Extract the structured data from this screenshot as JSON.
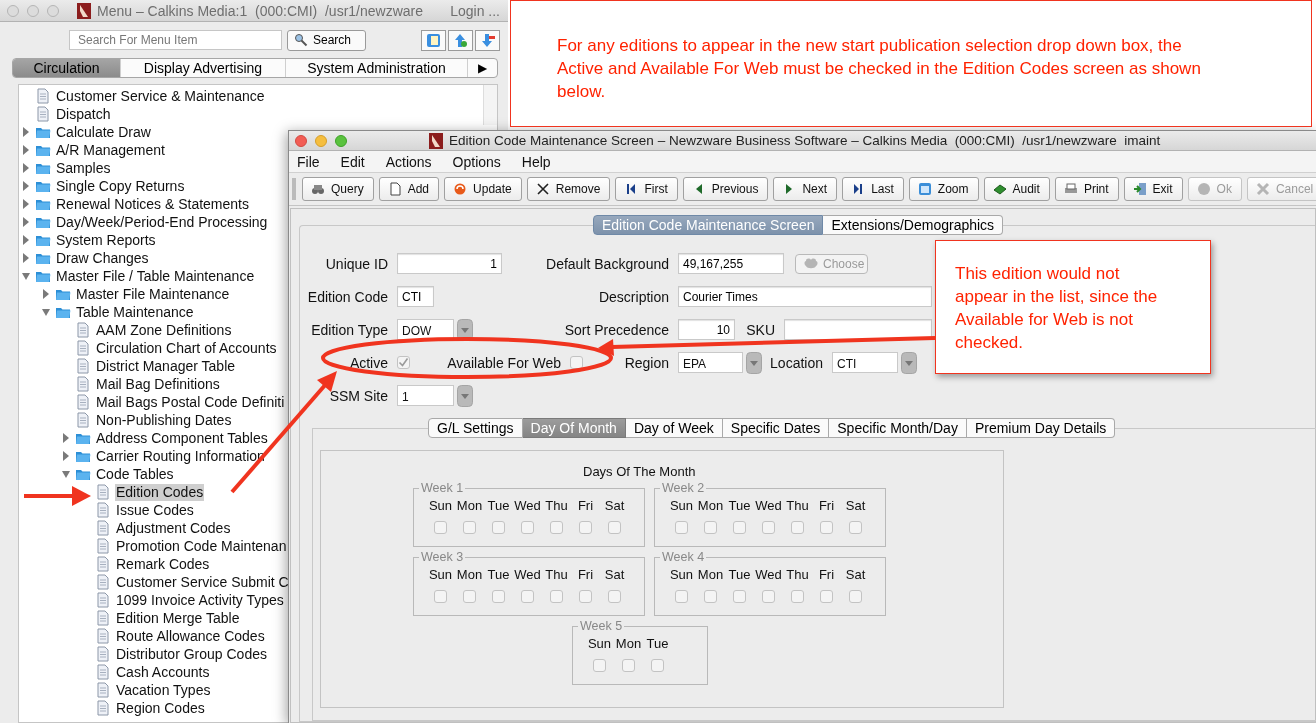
{
  "menu_window": {
    "title": "Menu – Calkins Media:1  (000:CMI)  /usr1/newzware",
    "login": "Login ...",
    "search": {
      "placeholder": "Search For Menu Item"
    },
    "search_button": "Search",
    "tabs": [
      {
        "label": "Circulation",
        "selected": true
      },
      {
        "label": "Display Advertising",
        "selected": false
      },
      {
        "label": "System Administration",
        "selected": false
      }
    ],
    "tab_scroll": "▶",
    "tree": [
      {
        "label": "Customer Service & Maintenance",
        "kind": "document",
        "selected": false
      },
      {
        "label": "Dispatch",
        "kind": "document",
        "selected": false
      },
      {
        "label": "Calculate Draw",
        "kind": "folder",
        "expanded": false,
        "selected": false
      },
      {
        "label": "A/R Management",
        "kind": "folder",
        "expanded": false,
        "selected": false
      },
      {
        "label": "Samples",
        "kind": "folder",
        "expanded": false,
        "selected": false
      },
      {
        "label": "Single Copy Returns",
        "kind": "folder",
        "expanded": false,
        "selected": false
      },
      {
        "label": "Renewal Notices & Statements",
        "kind": "folder",
        "expanded": false,
        "selected": false
      },
      {
        "label": "Day/Week/Period-End Processing",
        "kind": "folder",
        "expanded": false,
        "selected": false
      },
      {
        "label": "System Reports",
        "kind": "folder",
        "expanded": false,
        "selected": false
      },
      {
        "label": "Draw Changes",
        "kind": "folder",
        "expanded": false,
        "selected": false
      },
      {
        "label": "Master File / Table Maintenance",
        "kind": "folder",
        "expanded": true,
        "selected": false,
        "children": [
          {
            "label": "Master File Maintenance",
            "kind": "folder",
            "expanded": false,
            "selected": false
          },
          {
            "label": "Table Maintenance",
            "kind": "folder",
            "expanded": true,
            "selected": false,
            "children": [
              {
                "label": "AAM Zone Definitions",
                "kind": "document",
                "selected": false
              },
              {
                "label": "Circulation Chart of Accounts",
                "kind": "document",
                "selected": false
              },
              {
                "label": "District Manager Table",
                "kind": "document",
                "selected": false
              },
              {
                "label": "Mail Bag Definitions",
                "kind": "document",
                "selected": false
              },
              {
                "label": "Mail Bags Postal Code Definiti",
                "kind": "document",
                "selected": false
              },
              {
                "label": "Non-Publishing Dates",
                "kind": "document",
                "selected": false
              },
              {
                "label": "Address Component Tables",
                "kind": "folder",
                "expanded": false,
                "selected": false
              },
              {
                "label": "Carrier Routing Information",
                "kind": "folder",
                "expanded": false,
                "selected": false
              },
              {
                "label": "Code Tables",
                "kind": "folder",
                "expanded": true,
                "selected": false,
                "children": [
                  {
                    "label": "Edition Codes",
                    "kind": "document",
                    "selected": true
                  },
                  {
                    "label": "Issue Codes",
                    "kind": "document",
                    "selected": false
                  },
                  {
                    "label": "Adjustment Codes",
                    "kind": "document",
                    "selected": false
                  },
                  {
                    "label": "Promotion Code Maintenan",
                    "kind": "document",
                    "selected": false
                  },
                  {
                    "label": "Remark Codes",
                    "kind": "document",
                    "selected": false
                  },
                  {
                    "label": "Customer Service Submit C",
                    "kind": "document",
                    "selected": false
                  },
                  {
                    "label": "1099 Invoice Activity Types",
                    "kind": "document",
                    "selected": false
                  },
                  {
                    "label": "Edition Merge Table",
                    "kind": "document",
                    "selected": false
                  },
                  {
                    "label": "Route Allowance Codes",
                    "kind": "document",
                    "selected": false
                  },
                  {
                    "label": "Distributor Group Codes",
                    "kind": "document",
                    "selected": false
                  },
                  {
                    "label": "Cash Accounts",
                    "kind": "document",
                    "selected": false
                  },
                  {
                    "label": "Vacation Types",
                    "kind": "document",
                    "selected": false
                  },
                  {
                    "label": "Region Codes",
                    "kind": "document",
                    "selected": false
                  }
                ]
              }
            ]
          }
        ]
      }
    ]
  },
  "edition_window": {
    "title": "Edition Code Maintenance Screen – Newzware Business Software – Calkins Media  (000:CMI)  /usr1/newzware  imaint",
    "menus": [
      "File",
      "Edit",
      "Actions",
      "Options",
      "Help"
    ],
    "toolbar": [
      {
        "label": "Query",
        "disabled": false
      },
      {
        "label": "Add",
        "disabled": false
      },
      {
        "label": "Update",
        "disabled": false
      },
      {
        "label": "Remove",
        "disabled": false
      },
      {
        "label": "First",
        "disabled": false
      },
      {
        "label": "Previous",
        "disabled": false
      },
      {
        "label": "Next",
        "disabled": false
      },
      {
        "label": "Last",
        "disabled": false
      },
      {
        "label": "Zoom",
        "disabled": false
      },
      {
        "label": "Audit",
        "disabled": false
      },
      {
        "label": "Print",
        "disabled": false
      },
      {
        "label": "Exit",
        "disabled": false
      },
      {
        "label": "Ok",
        "disabled": true
      },
      {
        "label": "Cancel",
        "disabled": true
      }
    ],
    "tabs": [
      {
        "label": "Edition Code Maintenance Screen",
        "selected": true
      },
      {
        "label": "Extensions/Demographics",
        "selected": false
      }
    ],
    "form_rows": [
      [
        {
          "kind": "number",
          "label": "Unique ID",
          "value": "1"
        },
        {
          "kind": "text",
          "label": "Default Background",
          "value": "49,167,255"
        },
        {
          "kind": "button",
          "label": "Choose",
          "disabled": true
        }
      ],
      [
        {
          "kind": "text",
          "label": "Edition Code",
          "value": "CTI"
        },
        {
          "kind": "text",
          "label": "Description",
          "value": "Courier Times"
        }
      ],
      [
        {
          "kind": "dropdown",
          "label": "Edition Type",
          "value": "DOW"
        },
        {
          "kind": "number",
          "label": "Sort Precedence",
          "value": "10"
        },
        {
          "kind": "text",
          "label": "SKU"
        }
      ],
      [
        {
          "kind": "checkbox",
          "label": "Active",
          "checked": true
        },
        {
          "kind": "checkbox",
          "label": "Available For Web",
          "checked": false
        },
        {
          "kind": "dropdown",
          "label": "Region",
          "value": "EPA"
        },
        {
          "kind": "dropdown",
          "label": "Location",
          "value": "CTI"
        }
      ],
      [
        {
          "kind": "dropdown",
          "label": "SSM Site",
          "value": "1"
        }
      ]
    ],
    "subtabs": [
      {
        "label": "G/L Settings",
        "selected": false
      },
      {
        "label": "Day Of Month",
        "selected": true
      },
      {
        "label": "Day of Week",
        "selected": false
      },
      {
        "label": "Specific Dates",
        "selected": false
      },
      {
        "label": "Specific Month/Day",
        "selected": false
      },
      {
        "label": "Premium Day Details",
        "selected": false
      }
    ],
    "days_panel": {
      "title": "Days Of The Month",
      "weeks": [
        {
          "label": "Week 1",
          "days": [
            {
              "label": "Sun",
              "checked": false
            },
            {
              "label": "Mon",
              "checked": false
            },
            {
              "label": "Tue",
              "checked": false
            },
            {
              "label": "Wed",
              "checked": false
            },
            {
              "label": "Thu",
              "checked": false
            },
            {
              "label": "Fri",
              "checked": false
            },
            {
              "label": "Sat",
              "checked": false
            }
          ]
        },
        {
          "label": "Week 2",
          "days": [
            {
              "label": "Sun",
              "checked": false
            },
            {
              "label": "Mon",
              "checked": false
            },
            {
              "label": "Tue",
              "checked": false
            },
            {
              "label": "Wed",
              "checked": false
            },
            {
              "label": "Thu",
              "checked": false
            },
            {
              "label": "Fri",
              "checked": false
            },
            {
              "label": "Sat",
              "checked": false
            }
          ]
        },
        {
          "label": "Week 3",
          "days": [
            {
              "label": "Sun",
              "checked": false
            },
            {
              "label": "Mon",
              "checked": false
            },
            {
              "label": "Tue",
              "checked": false
            },
            {
              "label": "Wed",
              "checked": false
            },
            {
              "label": "Thu",
              "checked": false
            },
            {
              "label": "Fri",
              "checked": false
            },
            {
              "label": "Sat",
              "checked": false
            }
          ]
        },
        {
          "label": "Week 4",
          "days": [
            {
              "label": "Sun",
              "checked": false
            },
            {
              "label": "Mon",
              "checked": false
            },
            {
              "label": "Tue",
              "checked": false
            },
            {
              "label": "Wed",
              "checked": false
            },
            {
              "label": "Thu",
              "checked": false
            },
            {
              "label": "Fri",
              "checked": false
            },
            {
              "label": "Sat",
              "checked": false
            }
          ]
        },
        {
          "label": "Week 5",
          "days": [
            {
              "label": "Sun",
              "checked": false
            },
            {
              "label": "Mon",
              "checked": false
            },
            {
              "label": "Tue",
              "checked": false
            }
          ]
        }
      ]
    }
  },
  "callouts": [
    {
      "text": "For any editions to appear in the new start publication selection drop down box, the Active and Available For Web must be checked in the Edition Codes screen as shown below."
    },
    {
      "text": "This edition would not appear in the list, since the Available for Web is not checked."
    }
  ]
}
